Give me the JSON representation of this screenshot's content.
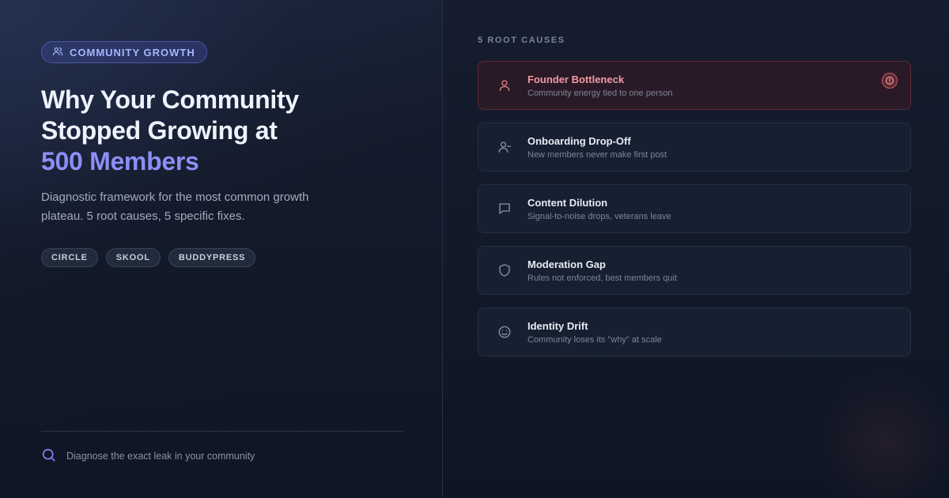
{
  "badge": {
    "label": "COMMUNITY GROWTH",
    "icon": "users-icon"
  },
  "title": {
    "line1": "Why Your Community",
    "line2": "Stopped Growing at",
    "accent": "500 Members"
  },
  "subtitle": "Diagnostic framework for the most common growth plateau. 5 root causes, 5 specific fixes.",
  "tags": [
    "CIRCLE",
    "SKOOL",
    "BUDDYPRESS"
  ],
  "footer": {
    "icon": "search-icon",
    "text": "Diagnose the exact leak in your community"
  },
  "section_label": "5 ROOT CAUSES",
  "causes": [
    {
      "title": "Founder Bottleneck",
      "desc": "Community energy tied to one person",
      "icon": "user-icon",
      "active": true,
      "status_icon": "alert-icon"
    },
    {
      "title": "Onboarding Drop-Off",
      "desc": "New members never make first post",
      "icon": "user-minus-icon",
      "active": false
    },
    {
      "title": "Content Dilution",
      "desc": "Signal-to-noise drops, veterans leave",
      "icon": "message-square-icon",
      "active": false
    },
    {
      "title": "Moderation Gap",
      "desc": "Rules not enforced, best members quit",
      "icon": "shield-icon",
      "active": false
    },
    {
      "title": "Identity Drift",
      "desc": "Community loses its \"why\" at scale",
      "icon": "smile-icon",
      "active": false
    }
  ],
  "colors": {
    "accent": "#8b8ff5",
    "active": "#f19aa2",
    "background": "#0f1624"
  }
}
